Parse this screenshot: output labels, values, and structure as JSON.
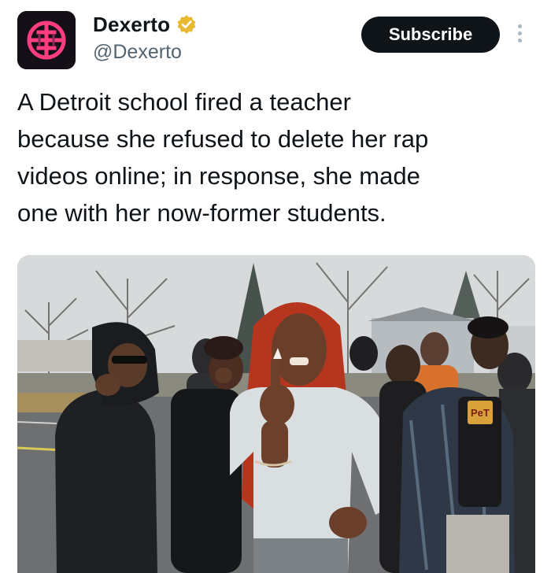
{
  "author": {
    "name": "Dexerto",
    "handle": "@Dexerto",
    "verified_badge": "verified-badge-icon",
    "avatar_icon": "dexerto-logo-icon"
  },
  "actions": {
    "subscribe_label": "Subscribe",
    "more_icon": "more-vertical-icon"
  },
  "tweet": {
    "text": "A Detroit school fired a teacher\nbecause she refused to delete her rap\nvideos online; in response, she made\none with her now-former students."
  },
  "media": {
    "type": "photo",
    "shirt_text": "PeT"
  },
  "colors": {
    "button_bg": "#0f1419",
    "handle_gray": "#536471",
    "verified_gold": "#e8b931",
    "logo_pink": "#ff3d7f"
  }
}
